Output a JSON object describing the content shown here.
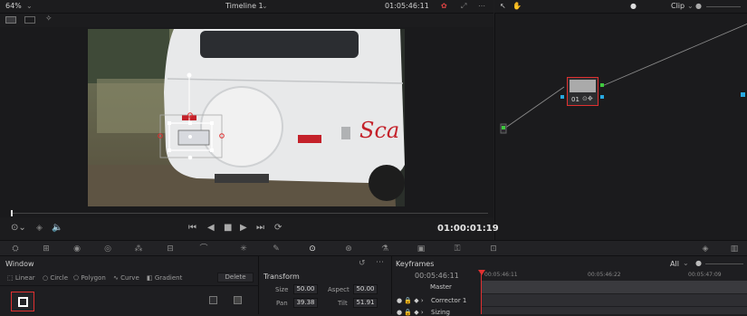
{
  "viewer": {
    "zoom": "64%",
    "timeline_title": "Timeline 1",
    "timecode_top": "01:05:46:11",
    "playhead_timecode": "01:00:01:19"
  },
  "node_editor": {
    "mode_label": "Clip",
    "node_label": "01"
  },
  "window_panel": {
    "title": "Window",
    "linear_label": "Linear",
    "circle_label": "Circle",
    "polygon_label": "Polygon",
    "curve_label": "Curve",
    "gradient_label": "Gradient",
    "delete_label": "Delete"
  },
  "transform_panel": {
    "title": "Transform",
    "size_label": "Size",
    "size_value": "50.00",
    "aspect_label": "Aspect",
    "aspect_value": "50.00",
    "pan_label": "Pan",
    "pan_value": "39.38",
    "tilt_label": "Tilt",
    "tilt_value": "51.91"
  },
  "keyframes_panel": {
    "title": "Keyframes",
    "filter_label": "All",
    "current_timecode": "00:05:46:11",
    "ruler_marks": [
      "00:05:46:11",
      "00:05:46:22",
      "00:05:47:09"
    ],
    "tracks": [
      "Master",
      "Corrector 1",
      "Sizing"
    ]
  },
  "colors": {
    "accent_red": "#e03030",
    "window_white": "#ffffff",
    "node_green": "#3ec83e",
    "node_blue": "#28a8e0"
  }
}
